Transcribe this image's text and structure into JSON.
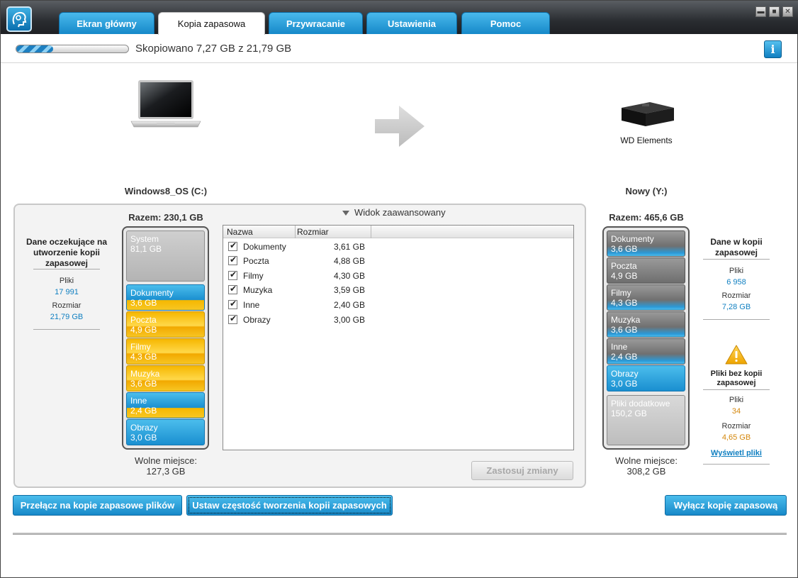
{
  "tabs": [
    {
      "label": "Ekran główny"
    },
    {
      "label": "Kopia zapasowa"
    },
    {
      "label": "Przywracanie"
    },
    {
      "label": "Ustawienia"
    },
    {
      "label": "Pomoc"
    }
  ],
  "window_controls": [
    "minimize",
    "maximize",
    "close"
  ],
  "progress": {
    "text": "Skopiowano 7,27 GB z 21,79 GB",
    "fraction": 0.33
  },
  "source": {
    "volume": "Windows8_OS (C:)",
    "total": "Razem: 230,1 GB",
    "free_label": "Wolne miejsce:",
    "free_value": "127,3 GB",
    "segments": [
      {
        "name": "System",
        "size": "81,1 GB"
      },
      {
        "name": "Dokumenty",
        "size": "3,6 GB"
      },
      {
        "name": "Poczta",
        "size": "4,9 GB"
      },
      {
        "name": "Filmy",
        "size": "4,3 GB"
      },
      {
        "name": "Muzyka",
        "size": "3,6 GB"
      },
      {
        "name": "Inne",
        "size": "2,4 GB"
      },
      {
        "name": "Obrazy",
        "size": "3,0 GB"
      }
    ]
  },
  "pending": {
    "title": "Dane oczekujące na utworzenie kopii zapasowej",
    "files_label": "Pliki",
    "files_value": "17 991",
    "size_label": "Rozmiar",
    "size_value": "21,79 GB"
  },
  "target": {
    "drive_name": "WD Elements",
    "volume": "Nowy (Y:)",
    "total": "Razem: 465,6 GB",
    "free_label": "Wolne miejsce:",
    "free_value": "308,2 GB",
    "segments": [
      {
        "name": "Dokumenty",
        "size": "3,6 GB"
      },
      {
        "name": "Poczta",
        "size": "4,9 GB"
      },
      {
        "name": "Filmy",
        "size": "4,3 GB"
      },
      {
        "name": "Muzyka",
        "size": "3,6 GB"
      },
      {
        "name": "Inne",
        "size": "2,4 GB"
      },
      {
        "name": "Obrazy",
        "size": "3,0 GB"
      },
      {
        "name": "Pliki dodatkowe",
        "size": "150,2 GB"
      }
    ]
  },
  "backed_up": {
    "title": "Dane w kopii zapasowej",
    "files_label": "Pliki",
    "files_value": "6 958",
    "size_label": "Rozmiar",
    "size_value": "7,28 GB"
  },
  "not_backed_up": {
    "title": "Pliki bez kopii zapasowej",
    "files_label": "Pliki",
    "files_value": "34",
    "size_label": "Rozmiar",
    "size_value": "4,65 GB",
    "link": "Wyświetl pliki"
  },
  "advanced": {
    "toggle_label": "Widok zaawansowany",
    "columns": [
      "Nazwa",
      "Rozmiar"
    ],
    "rows": [
      {
        "name": "Dokumenty",
        "size": "3,61 GB",
        "checked": true
      },
      {
        "name": "Poczta",
        "size": "4,88 GB",
        "checked": true
      },
      {
        "name": "Filmy",
        "size": "4,30 GB",
        "checked": true
      },
      {
        "name": "Muzyka",
        "size": "3,59 GB",
        "checked": true
      },
      {
        "name": "Inne",
        "size": "2,40 GB",
        "checked": true
      },
      {
        "name": "Obrazy",
        "size": "3,00 GB",
        "checked": true
      }
    ],
    "apply_label": "Zastosuj zmiany"
  },
  "buttons": {
    "switch_label": "Przełącz na kopie zapasowe plików",
    "frequency_label": "Ustaw częstość tworzenia kopii zapasowych",
    "disable_label": "Wyłącz kopię zapasową"
  },
  "colors": {
    "accent": "#1a8fd0",
    "category": "#f5b800",
    "warning": "#f3b81c"
  }
}
